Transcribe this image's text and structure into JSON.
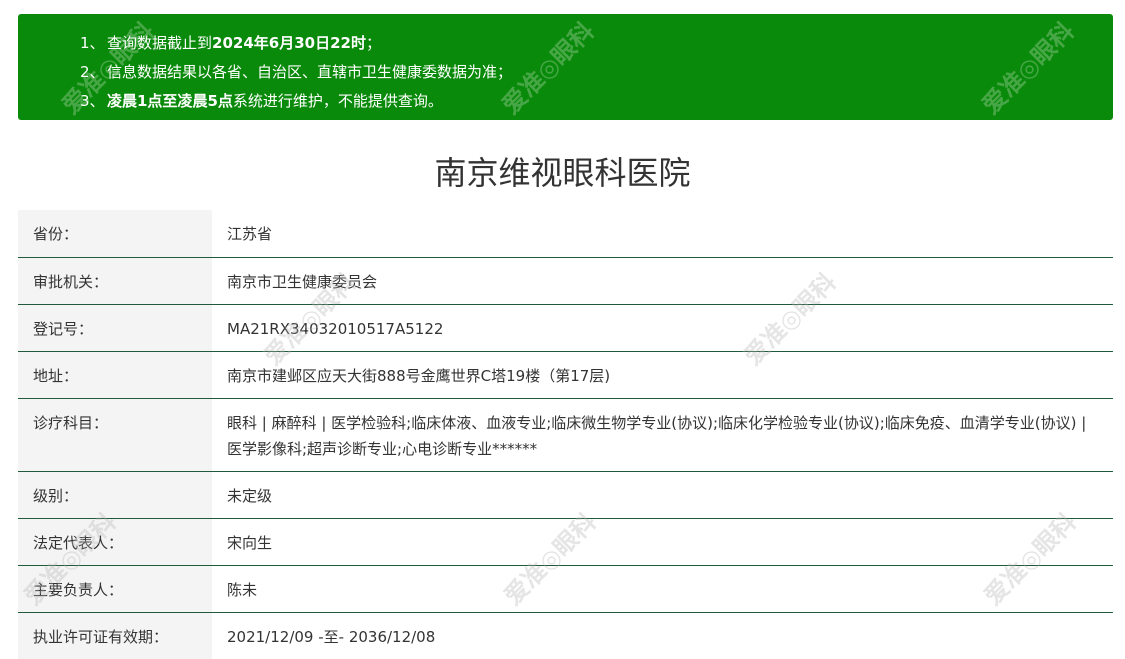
{
  "notice": {
    "lines": [
      {
        "num": "1、",
        "pre": "查询数据截止到",
        "bold": "2024年6月30日22时",
        "post": "；"
      },
      {
        "num": "2、",
        "pre": "信息数据结果以各省、自治区、直辖市卫生健康委数据为准；",
        "bold": "",
        "post": ""
      },
      {
        "num": "3、",
        "pre": "",
        "bold": "凌晨1点至凌晨5点",
        "post": "系统进行维护，不能提供查询。"
      }
    ]
  },
  "title": "南京维视眼科医院",
  "rows": [
    {
      "label": "省份：",
      "value": "江苏省"
    },
    {
      "label": "审批机关：",
      "value": "南京市卫生健康委员会"
    },
    {
      "label": "登记号：",
      "value": "MA21RX34032010517A5122"
    },
    {
      "label": "地址：",
      "value": "南京市建邺区应天大街888号金鹰世界C塔19楼（第17层)"
    },
    {
      "label": "诊疗科目：",
      "value": "眼科 | 麻醉科 | 医学检验科;临床体液、血液专业;临床微生物学专业(协议);临床化学检验专业(协议);临床免疫、血清学专业(协议) | 医学影像科;超声诊断专业;心电诊断专业******"
    },
    {
      "label": "级别：",
      "value": "未定级"
    },
    {
      "label": "法定代表人：",
      "value": "宋向生"
    },
    {
      "label": "主要负责人：",
      "value": "陈未"
    },
    {
      "label": "执业许可证有效期：",
      "value": "2021/12/09 -至- 2036/12/08"
    }
  ],
  "watermark_text": "爱准◎眼科"
}
